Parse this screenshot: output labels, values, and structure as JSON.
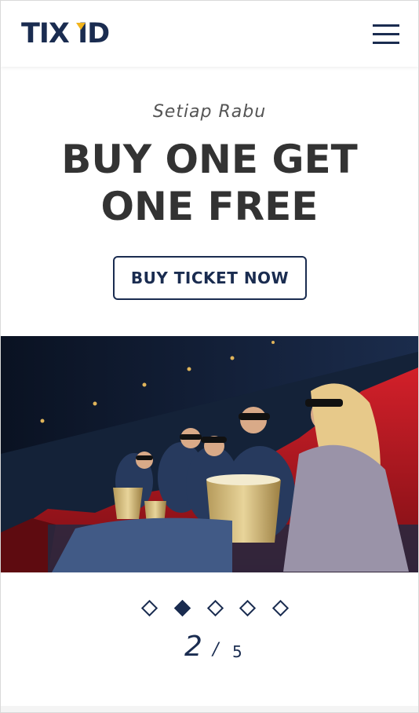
{
  "header": {
    "logo_text": "TIX ID",
    "menu_icon": "hamburger-menu-icon",
    "brand_color": "#1a2c50",
    "logo_accent_color": "#f2b41c"
  },
  "hero": {
    "tagline": "Setiap Rabu",
    "headline": "BUY ONE GET ONE FREE",
    "cta_label": "BUY TICKET NOW"
  },
  "carousel": {
    "image": "cinema-audience-3d-glasses-photo",
    "slide_count": 5,
    "active_index": 2,
    "current_label": "2",
    "separator": "/",
    "total_label": "5"
  }
}
